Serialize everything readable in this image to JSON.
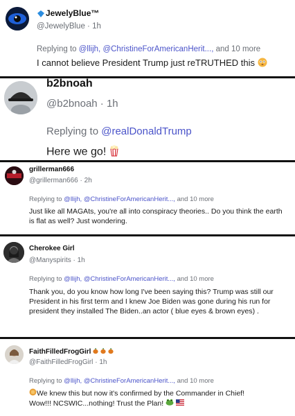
{
  "posts": [
    {
      "display_name": "JewelyBlue™",
      "handle": "@JewelyBlue",
      "time": "1h",
      "replying_prefix": "Replying to",
      "mentions": [
        "@llijh,",
        "@ChristineForAmericanHerit...,"
      ],
      "replying_suffix": "and 10 more",
      "text": "I cannot believe President Trump just reTRUTHED this"
    },
    {
      "display_name": "b2bnoah",
      "handle": "@b2bnoah",
      "time": "1h",
      "replying_prefix": "Replying to",
      "mentions": [
        "@realDonaldTrump"
      ],
      "replying_suffix": "",
      "text": "Here we go!"
    },
    {
      "display_name": "grillerman666",
      "handle": "@grillerman666",
      "time": "2h",
      "replying_prefix": "Replying to",
      "mentions": [
        "@llijh,",
        "@ChristineForAmericanHerit...,"
      ],
      "replying_suffix": "and 10 more",
      "text": "Just like all MAGAts, you're all into conspiracy theories.. Do you think the earth is flat as well?  Just wondering."
    },
    {
      "display_name": "Cherokee Girl",
      "handle": "@Manyspirits",
      "time": "1h",
      "replying_prefix": "Replying to",
      "mentions": [
        "@llijh,",
        "@ChristineForAmericanHerit...,"
      ],
      "replying_suffix": "and 10 more",
      "text": "Thank you, do you know how long I've been saying this? Trump was still our President in his first term and I knew Joe Biden was gone during his run for president they installed The Biden..an actor ( blue eyes & brown eyes) ."
    },
    {
      "display_name": "FaithFilledFrogGirl",
      "handle": "@FaithFilledFrogGirl",
      "time": "1h",
      "replying_prefix": "Replying to",
      "mentions": [
        "@llijh,",
        "@ChristineForAmericanHerit...,"
      ],
      "replying_suffix": "and 10 more",
      "text_line1": "We knew this but now it's confirmed by the Commander in Chief!",
      "text_line2": "Wow!!! NCSWIC...nothing! Trust the Plan!"
    }
  ],
  "separator": "·",
  "colors": {
    "mention": "#4a53c9",
    "meta": "#6b6f76",
    "divider": "#111111"
  },
  "icons": [
    "verified-diamond-icon",
    "flushed-face-emoji",
    "popcorn-emoji",
    "hand-emoji",
    "frog-emoji",
    "us-flag-emoji",
    "pumpkin-icon"
  ]
}
